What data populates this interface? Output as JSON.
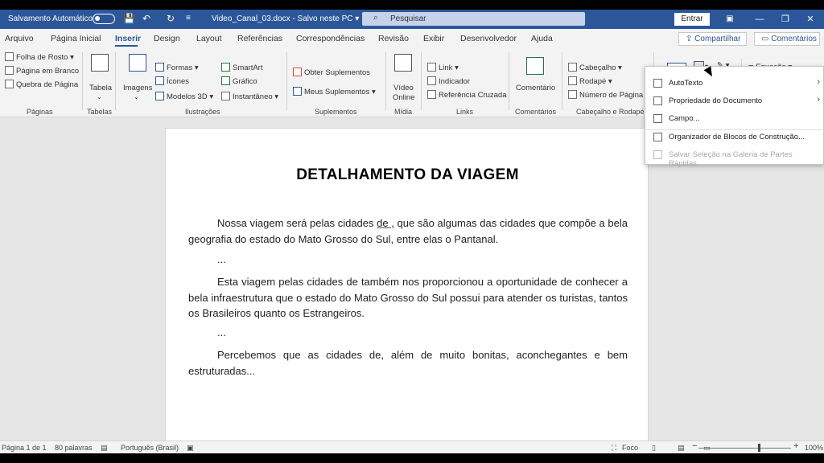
{
  "titlebar": {
    "autosave_label": "Salvamento Automático",
    "document_label": "Video_Canal_03.docx  -  Salvo neste PC  ▾",
    "search_placeholder": "Pesquisar",
    "signin_label": "Entrar",
    "undo_icon": "↶",
    "redo_icon": "↻",
    "save_icon": "💾",
    "minimize_icon": "—",
    "restore_icon": "❐",
    "close_icon": "✕"
  },
  "tabs": [
    "Arquivo",
    "Página Inicial",
    "Inserir",
    "Design",
    "Layout",
    "Referências",
    "Correspondências",
    "Revisão",
    "Exibir",
    "Desenvolvedor",
    "Ajuda"
  ],
  "active_tab": "Inserir",
  "share_label": "Compartilhar",
  "comments_label": "Comentários",
  "ribbon": {
    "paginas": {
      "folha_rosto": "Folha de Rosto ▾",
      "pagina_branco": "Página em Branco",
      "quebra": "Quebra de Página",
      "label": "Páginas"
    },
    "tabelas": {
      "tabela": "Tabela",
      "label": "Tabelas"
    },
    "ilustracoes": {
      "imagens": "Imagens",
      "formas": "Formas ▾",
      "icones": "Ícones",
      "modelos3d": "Modelos 3D  ▾",
      "smartart": "SmartArt",
      "grafico": "Gráfico",
      "instantaneo": "Instantâneo ▾",
      "label": "Ilustrações"
    },
    "suplementos": {
      "obter": "Obter Suplementos",
      "meus": "Meus Suplementos  ▾",
      "label": "Suplementos"
    },
    "midia": {
      "video": "Vídeo",
      "online": "Online",
      "label": "Mídia"
    },
    "links": {
      "link": "Link ▾",
      "indicador": "Indicador",
      "referencia": "Referência Cruzada",
      "label": "Links"
    },
    "comentarios": {
      "comentario": "Comentário",
      "label": "Comentários"
    },
    "cabecalho": {
      "cabecalho": "Cabeçalho ▾",
      "rodape": "Rodapé ▾",
      "numero": "Número de Página ▾",
      "label": "Cabeçalho e Rodapé"
    },
    "texto": {
      "equacao": "Equação  ▾"
    }
  },
  "document": {
    "title": "DETALHAMENTO DA VIAGEM",
    "p1_a": "Nossa viagem será pelas cidades ",
    "p1_u": "de ,",
    "p1_b": " que são algumas das cidades que compõe a bela geografia do estado do Mato Grosso do Sul, entre elas o Pantanal.",
    "dots1": "...",
    "p2": "Esta viagem pelas cidades de também nos proporcionou a oportunidade de conhecer a bela infraestrutura que o estado do Mato Grosso do Sul possui para atender os turistas, tantos os Brasileiros quanto os Estrangeiros.",
    "dots2": "...",
    "p3": "Percebemos que as cidades de, além de muito bonitas, aconchegantes e bem estruturadas..."
  },
  "dropdown": {
    "autotexto": "AutoTexto",
    "propriedade": "Propriedade do Documento",
    "campo": "Campo...",
    "organizador": "Organizador de Blocos de Construção...",
    "salvar": "Salvar Seleção na Galeria de Partes Rápidas..."
  },
  "statusbar": {
    "pagina": "Página 1 de 1",
    "palavras": "80 palavras",
    "idioma": "Português (Brasil)",
    "foco": "Foco",
    "zoom": "100%",
    "zoom_level": 1.0
  }
}
